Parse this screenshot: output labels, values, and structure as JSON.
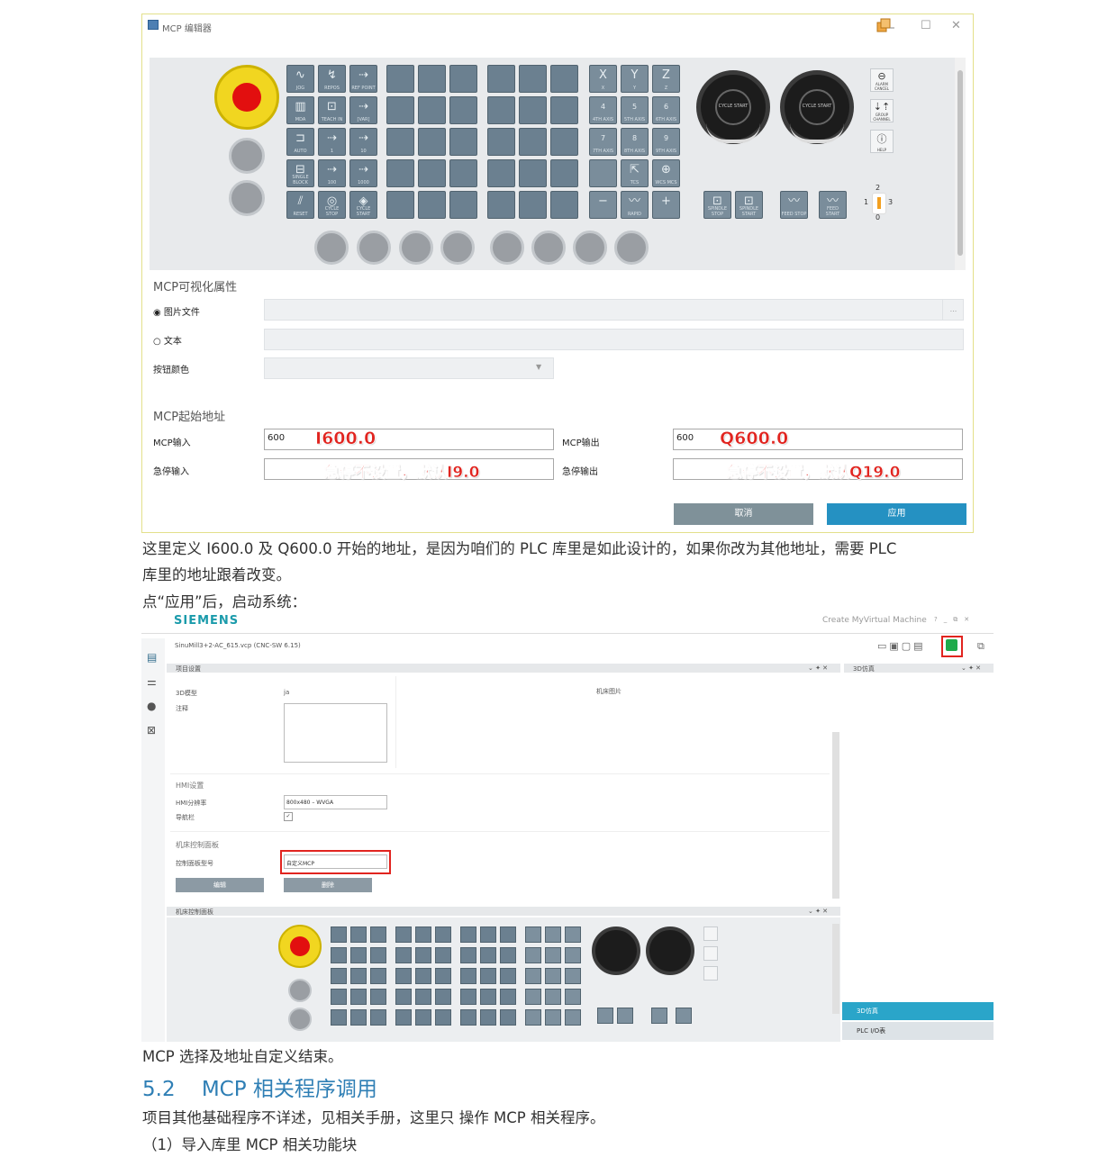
{
  "window": {
    "title": "MCP 编辑器",
    "minimize_glyph": "☐",
    "close_glyph": "✕"
  },
  "mcp_keys": {
    "row1": [
      "JOG",
      "REPOS",
      "REF POINT"
    ],
    "row2": [
      "MDA",
      "TEACH IN",
      "[VAR]"
    ],
    "row3": [
      "AUTO",
      "1",
      "10"
    ],
    "row4": [
      "SINGLE BLOCK",
      "100",
      "1000"
    ],
    "row5": [
      "RESET",
      "CYCLE STOP",
      "CYCLE START"
    ],
    "axis_row1": [
      "X",
      "Y",
      "Z"
    ],
    "axis_row2": [
      "4",
      "5",
      "6"
    ],
    "axis_row2_sub": [
      "4TH AXIS",
      "5TH AXIS",
      "6TH AXIS"
    ],
    "axis_row3": [
      "7",
      "8",
      "9"
    ],
    "axis_row3_sub": [
      "7TH AXIS",
      "8TH AXIS",
      "9TH AXIS"
    ],
    "axis_row4_sub": [
      "TCS",
      "WCS MCS"
    ],
    "axis_row5": [
      "−",
      "RAPID",
      "+"
    ],
    "knob_label": "CYCLE START",
    "spindle_keys": [
      "SPINDLE STOP",
      "SPINDLE START",
      "FEED STOP",
      "FEED START"
    ],
    "side_keys": [
      "ALARM CANCEL",
      "GROUP CHANNEL",
      "HELP"
    ],
    "selector": {
      "top": "2",
      "left": "1",
      "right": "3",
      "bottom": "0"
    }
  },
  "visual_props": {
    "section_title": "MCP可视化属性",
    "image_file_label": "图片文件",
    "text_label": "文本",
    "button_color_label": "按钮颜色",
    "browse_glyph": "...",
    "dropdown_glyph": "▼"
  },
  "address": {
    "section_title": "MCP起始地址",
    "mcp_input_label": "MCP输入",
    "mcp_input_value": "600",
    "mcp_input_note": "I600.0",
    "mcp_output_label": "MCP输出",
    "mcp_output_value": "600",
    "mcp_output_note": "Q600.0",
    "estop_input_label": "急停输入",
    "estop_input_note": "急停不设置，默认I9.0",
    "estop_output_label": "急停输出",
    "estop_output_note": "急停不设置，默认Q19.0"
  },
  "buttons": {
    "cancel": "取消",
    "apply": "应用"
  },
  "colors": {
    "cancel": "#7f9199",
    "apply": "#2591c2",
    "note_red": "#e1241f",
    "heading_blue": "#2f7fb5"
  },
  "text": {
    "p1_line1": "这里定义 I600.0 及 Q600.0 开始的地址，是因为咱们的 PLC 库里是如此设计的，如果你改为其他地址，需要 PLC",
    "p1_line2": "库里的地址跟着改变。",
    "p2": "点“应用”后，启动系统：",
    "p3": "MCP 选择及地址自定义结束。",
    "heading": "5.2    MCP 相关程序调用",
    "p4": "项目其他基础程序不详述，见相关手册，这里只 操作 MCP 相关程序。",
    "p5": "（1）导入库里 MCP 相关功能块"
  },
  "create_mymachine": {
    "brand": "SIEMENS",
    "app_title": "Create MyVirtual Machine",
    "window_glyphs": [
      "?",
      "_",
      "⧉",
      "✕"
    ],
    "project_file": "SinuMill3+2-AC_615.vcp (CNC-SW 6.15)",
    "project_panel_title": "项目设置",
    "row_3d_model_label": "3D模型",
    "row_3d_model_value": "ja",
    "row_comment_label": "注释",
    "machine_image_label": "机床图片",
    "hmi_section": "HMI设置",
    "hmi_resolution_label": "HMI分辨率",
    "hmi_resolution_value": "800x480 – WVGA",
    "nav_label": "导航栏",
    "mcp_section": "机床控制面板",
    "mcp_type_label": "控制面板型号",
    "mcp_type_value": "自定义MCP",
    "edit_btn": "编辑",
    "delete_btn": "删除",
    "mcp_panel_title": "机床控制面板",
    "sim_panel_title": "3D仿真",
    "tab_3d_sim": "3D仿真",
    "tab_plc_io": "PLC I/O表",
    "panel_ctrls": "⌄ ✦ ✕"
  }
}
